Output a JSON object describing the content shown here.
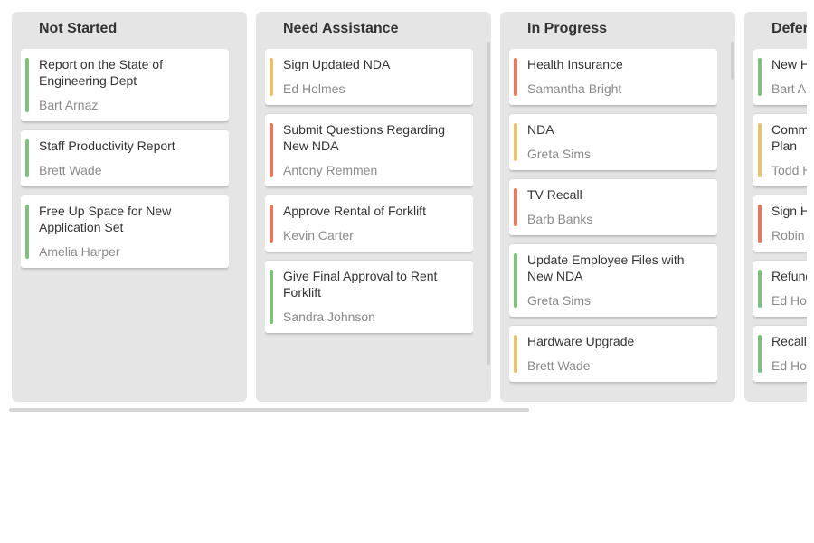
{
  "colors": {
    "green": "#7dc27a",
    "yellow": "#e9c46a",
    "red": "#e8765c"
  },
  "columns": [
    {
      "title": "Not Started",
      "cards": [
        {
          "title": "Report on the State of Engineering Dept",
          "assignee": "Bart Arnaz",
          "priority": "green"
        },
        {
          "title": "Staff Productivity Report",
          "assignee": "Brett Wade",
          "priority": "green"
        },
        {
          "title": "Free Up Space for New Application Set",
          "assignee": "Amelia Harper",
          "priority": "green"
        }
      ]
    },
    {
      "title": "Need Assistance",
      "cards": [
        {
          "title": "Sign Updated NDA",
          "assignee": "Ed Holmes",
          "priority": "yellow"
        },
        {
          "title": "Submit Questions Regarding New NDA",
          "assignee": "Antony Remmen",
          "priority": "red"
        },
        {
          "title": "Approve Rental of Forklift",
          "assignee": "Kevin Carter",
          "priority": "red"
        },
        {
          "title": "Give Final Approval to Rent Forklift",
          "assignee": "Sandra Johnson",
          "priority": "green"
        }
      ]
    },
    {
      "title": "In Progress",
      "cards": [
        {
          "title": "Health Insurance",
          "assignee": "Samantha Bright",
          "priority": "red"
        },
        {
          "title": "NDA",
          "assignee": "Greta Sims",
          "priority": "yellow"
        },
        {
          "title": "TV Recall",
          "assignee": "Barb Banks",
          "priority": "red"
        },
        {
          "title": "Update Employee Files with New NDA",
          "assignee": "Greta Sims",
          "priority": "green"
        },
        {
          "title": "Hardware Upgrade",
          "assignee": "Brett Wade",
          "priority": "yellow"
        }
      ]
    },
    {
      "title": "Deferred",
      "cards": [
        {
          "title": "New Hire Orientation",
          "assignee": "Bart Arnaz",
          "priority": "green"
        },
        {
          "title": "Communicate the New Project Plan",
          "assignee": "Todd Hoffman",
          "priority": "yellow"
        },
        {
          "title": "Sign Health Insurance Forms",
          "assignee": "Robin Cosworth",
          "priority": "red"
        },
        {
          "title": "Refund Request",
          "assignee": "Ed Holmes",
          "priority": "green"
        },
        {
          "title": "Recall Rebate Form",
          "assignee": "Ed Holmes",
          "priority": "green"
        }
      ]
    }
  ]
}
